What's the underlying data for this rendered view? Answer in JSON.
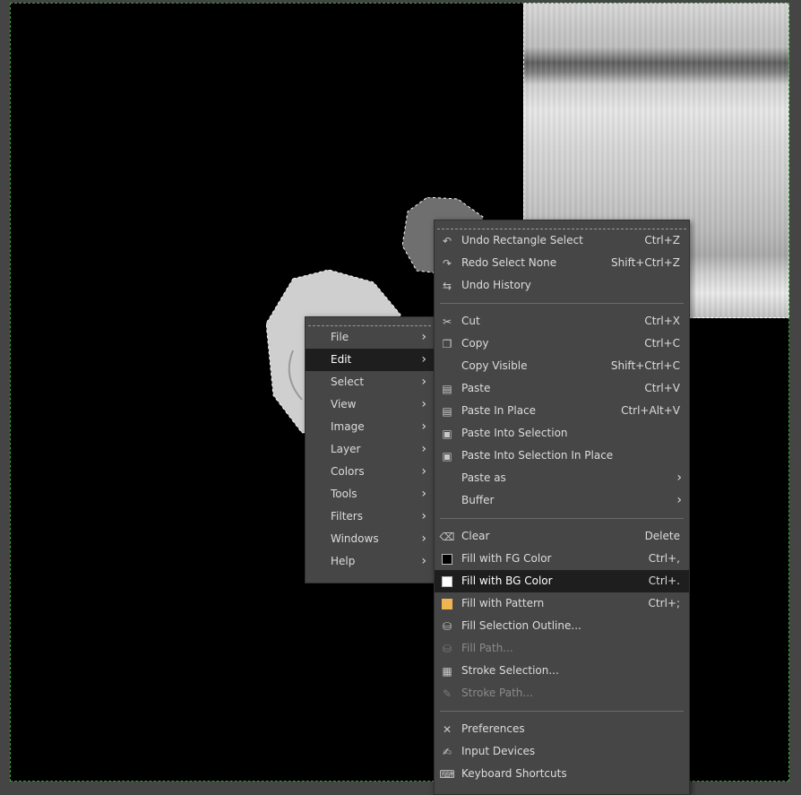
{
  "main_menu": {
    "items": [
      {
        "label": "File"
      },
      {
        "label": "Edit"
      },
      {
        "label": "Select"
      },
      {
        "label": "View"
      },
      {
        "label": "Image"
      },
      {
        "label": "Layer"
      },
      {
        "label": "Colors"
      },
      {
        "label": "Tools"
      },
      {
        "label": "Filters"
      },
      {
        "label": "Windows"
      },
      {
        "label": "Help"
      }
    ],
    "highlighted": "Edit"
  },
  "edit_menu": {
    "undo": {
      "label": "Undo Rectangle Select",
      "accel": "Ctrl+Z"
    },
    "redo": {
      "label": "Redo Select None",
      "accel": "Shift+Ctrl+Z"
    },
    "undo_history": {
      "label": "Undo History"
    },
    "cut": {
      "label": "Cut",
      "accel": "Ctrl+X"
    },
    "copy": {
      "label": "Copy",
      "accel": "Ctrl+C"
    },
    "copy_visible": {
      "label": "Copy Visible",
      "accel": "Shift+Ctrl+C"
    },
    "paste": {
      "label": "Paste",
      "accel": "Ctrl+V"
    },
    "paste_in_place": {
      "label": "Paste In Place",
      "accel": "Ctrl+Alt+V"
    },
    "paste_into_selection": {
      "label": "Paste Into Selection"
    },
    "paste_into_selection_in_place": {
      "label": "Paste Into Selection In Place"
    },
    "paste_as": {
      "label": "Paste as"
    },
    "buffer": {
      "label": "Buffer"
    },
    "clear": {
      "label": "Clear",
      "accel": "Delete"
    },
    "fill_fg": {
      "label": "Fill with FG Color",
      "accel": "Ctrl+,"
    },
    "fill_bg": {
      "label": "Fill with BG Color",
      "accel": "Ctrl+."
    },
    "fill_pattern": {
      "label": "Fill with Pattern",
      "accel": "Ctrl+;"
    },
    "fill_selection_outline": {
      "label": "Fill Selection Outline..."
    },
    "fill_path": {
      "label": "Fill Path..."
    },
    "stroke_selection": {
      "label": "Stroke Selection..."
    },
    "stroke_path": {
      "label": "Stroke Path..."
    },
    "preferences": {
      "label": "Preferences"
    },
    "input_devices": {
      "label": "Input Devices"
    },
    "keyboard_shortcuts": {
      "label": "Keyboard Shortcuts"
    }
  },
  "colors": {
    "fg_swatch": "#000000",
    "bg_swatch": "#ffffff",
    "pattern_swatch": "#f0b450",
    "selection_marching_ants": "#3aa03a",
    "menu_background": "#464646",
    "menu_highlight": "#1e1e1e"
  }
}
